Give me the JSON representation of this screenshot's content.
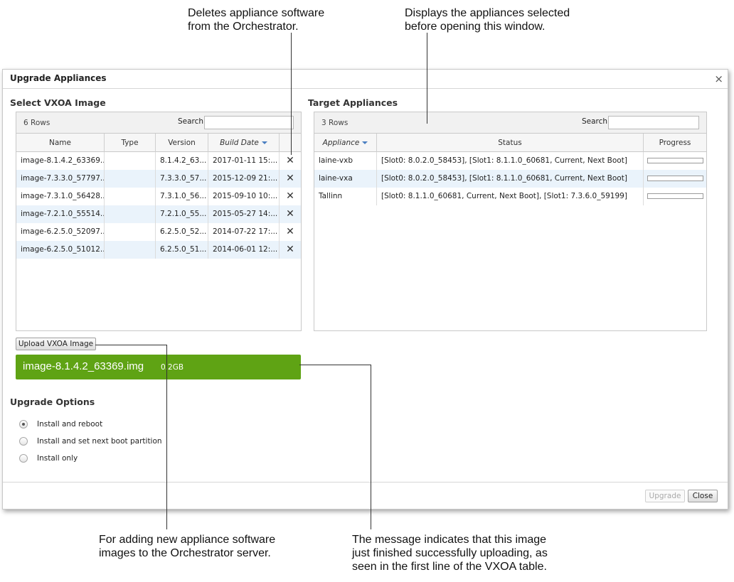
{
  "callouts": {
    "delete": [
      "Deletes appliance software",
      "from the Orchestrator."
    ],
    "targets": [
      "Displays the appliances selected",
      "before opening this window."
    ],
    "upload": [
      "For adding new appliance software",
      "images to the Orchestrator server."
    ],
    "message": [
      "The message indicates that this image",
      "just finished successfully uploading, as",
      "seen in the first line of the VXOA table."
    ]
  },
  "dialog": {
    "title": "Upgrade Appliances",
    "close_icon": "×"
  },
  "vxoa": {
    "heading": "Select VXOA Image",
    "rows_count": "6 Rows",
    "search_label": "Search",
    "search_value": "",
    "columns": [
      "Name",
      "Type",
      "Version",
      "Build Date"
    ],
    "delete_icon": "✕",
    "rows": [
      {
        "name": "image-8.1.4.2_63369...",
        "type": "",
        "version": "8.1.4.2_63...",
        "build_date": "2017-01-11 15:..."
      },
      {
        "name": "image-7.3.3.0_57797...",
        "type": "",
        "version": "7.3.3.0_57...",
        "build_date": "2015-12-09 21:..."
      },
      {
        "name": "image-7.3.1.0_56428...",
        "type": "",
        "version": "7.3.1.0_56...",
        "build_date": "2015-09-10 10:..."
      },
      {
        "name": "image-7.2.1.0_55514...",
        "type": "",
        "version": "7.2.1.0_55...",
        "build_date": "2015-05-27 14:..."
      },
      {
        "name": "image-6.2.5.0_52097...",
        "type": "",
        "version": "6.2.5.0_52...",
        "build_date": "2014-07-22 17:..."
      },
      {
        "name": "image-6.2.5.0_51012...",
        "type": "",
        "version": "6.2.5.0_51...",
        "build_date": "2014-06-01 12:..."
      }
    ],
    "upload_button": "Upload VXOA Image",
    "upload_message": {
      "filename": "image-8.1.4.2_63369.img",
      "size": "0.2GB"
    }
  },
  "targets": {
    "heading": "Target Appliances",
    "rows_count": "3 Rows",
    "search_label": "Search",
    "search_value": "",
    "columns": [
      "Appliance",
      "Status",
      "Progress"
    ],
    "rows": [
      {
        "appliance": "laine-vxb",
        "status": "[Slot0: 8.0.2.0_58453], [Slot1: 8.1.1.0_60681, Current, Next Boot]",
        "progress": 0
      },
      {
        "appliance": "laine-vxa",
        "status": "[Slot0: 8.0.2.0_58453], [Slot1: 8.1.1.0_60681, Current, Next Boot]",
        "progress": 0
      },
      {
        "appliance": "Tallinn",
        "status": "[Slot0: 8.1.1.0_60681, Current, Next Boot], [Slot1: 7.3.6.0_59199]",
        "progress": 0
      }
    ]
  },
  "options": {
    "heading": "Upgrade Options",
    "items": [
      {
        "label": "Install and reboot",
        "checked": true
      },
      {
        "label": "Install and set next boot partition",
        "checked": false
      },
      {
        "label": "Install only",
        "checked": false
      }
    ]
  },
  "footer": {
    "upgrade_button": "Upgrade",
    "close_button": "Close"
  }
}
